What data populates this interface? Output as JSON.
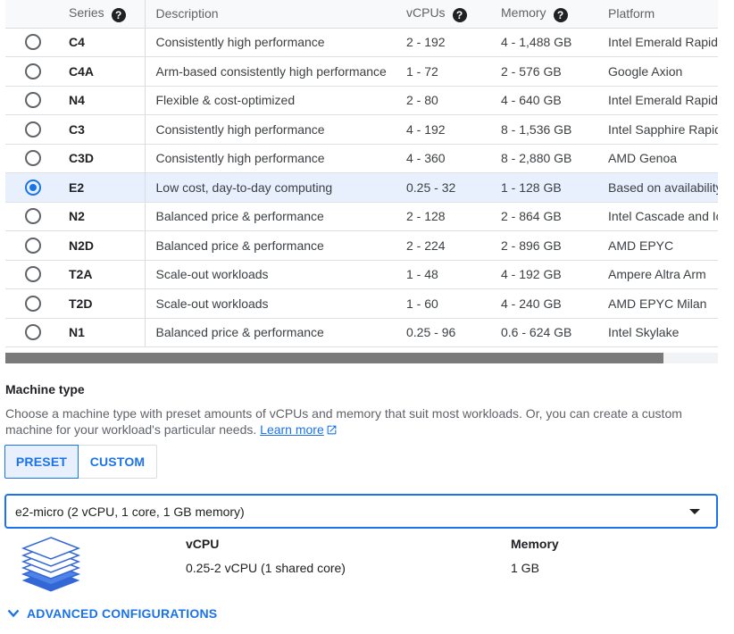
{
  "table": {
    "headers": {
      "series": "Series",
      "description": "Description",
      "vcpus": "vCPUs",
      "memory": "Memory",
      "platform": "Platform"
    },
    "rows": [
      {
        "series": "C4",
        "description": "Consistently high performance",
        "vcpus": "2 - 192",
        "memory": "4 - 1,488 GB",
        "platform": "Intel Emerald Rapids",
        "selected": false
      },
      {
        "series": "C4A",
        "description": "Arm-based consistently high performance",
        "vcpus": "1 - 72",
        "memory": "2 - 576 GB",
        "platform": "Google Axion",
        "selected": false
      },
      {
        "series": "N4",
        "description": "Flexible & cost-optimized",
        "vcpus": "2 - 80",
        "memory": "4 - 640 GB",
        "platform": "Intel Emerald Rapids",
        "selected": false
      },
      {
        "series": "C3",
        "description": "Consistently high performance",
        "vcpus": "4 - 192",
        "memory": "8 - 1,536 GB",
        "platform": "Intel Sapphire Rapids",
        "selected": false
      },
      {
        "series": "C3D",
        "description": "Consistently high performance",
        "vcpus": "4 - 360",
        "memory": "8 - 2,880 GB",
        "platform": "AMD Genoa",
        "selected": false
      },
      {
        "series": "E2",
        "description": "Low cost, day-to-day computing",
        "vcpus": "0.25 - 32",
        "memory": "1 - 128 GB",
        "platform": "Based on availability",
        "selected": true
      },
      {
        "series": "N2",
        "description": "Balanced price & performance",
        "vcpus": "2 - 128",
        "memory": "2 - 864 GB",
        "platform": "Intel Cascade and Ice Lake",
        "selected": false
      },
      {
        "series": "N2D",
        "description": "Balanced price & performance",
        "vcpus": "2 - 224",
        "memory": "2 - 896 GB",
        "platform": "AMD EPYC",
        "selected": false
      },
      {
        "series": "T2A",
        "description": "Scale-out workloads",
        "vcpus": "1 - 48",
        "memory": "4 - 192 GB",
        "platform": "Ampere Altra Arm",
        "selected": false
      },
      {
        "series": "T2D",
        "description": "Scale-out workloads",
        "vcpus": "1 - 60",
        "memory": "4 - 240 GB",
        "platform": "AMD EPYC Milan",
        "selected": false
      },
      {
        "series": "N1",
        "description": "Balanced price & performance",
        "vcpus": "0.25 - 96",
        "memory": "0.6 - 624 GB",
        "platform": "Intel Skylake",
        "selected": false
      }
    ]
  },
  "machine_type": {
    "label": "Machine type",
    "description": "Choose a machine type with preset amounts of vCPUs and memory that suit most workloads. Or, you can create a custom machine for your workload's particular needs.",
    "learn_more": "Learn more",
    "preset_label": "PRESET",
    "custom_label": "CUSTOM",
    "selected_value": "e2-micro (2 vCPU, 1 core, 1 GB memory)",
    "vcpu_heading": "vCPU",
    "vcpu_value": "0.25-2 vCPU (1 shared core)",
    "memory_heading": "Memory",
    "memory_value": "1 GB"
  },
  "advanced": {
    "label": "ADVANCED CONFIGURATIONS"
  },
  "colors": {
    "accent": "#1a73e8",
    "selected_row": "#e8f0fe",
    "header_bg": "#f8f9fa",
    "chip_icon": "#3367d6"
  },
  "icons": [
    "help-icon",
    "external-link-icon",
    "dropdown-caret-icon",
    "chevron-down-icon",
    "machine-stack-icon"
  ]
}
